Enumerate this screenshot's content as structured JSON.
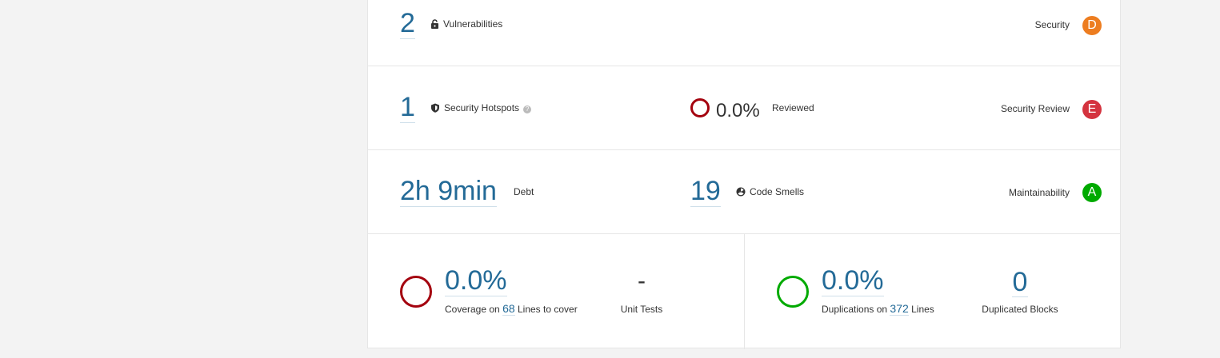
{
  "security": {
    "count": "2",
    "label": "Vulnerabilities",
    "rating_label": "Security",
    "rating": "D",
    "rating_color": "#ed7d20"
  },
  "hotspots": {
    "count": "1",
    "label": "Security Hotspots",
    "help": "?",
    "reviewed_pct": "0.0%",
    "reviewed_label": "Reviewed",
    "reviewed_ring_color": "#a4030f",
    "rating_label": "Security Review",
    "rating": "E",
    "rating_color": "#d4333f"
  },
  "maintainability": {
    "debt": "2h 9min",
    "debt_label": "Debt",
    "smells_count": "19",
    "smells_label": "Code Smells",
    "rating_label": "Maintainability",
    "rating": "A",
    "rating_color": "#00aa00"
  },
  "coverage": {
    "ring_color": "#a4030f",
    "value": "0.0%",
    "prefix": "Coverage on",
    "lines": "68",
    "suffix": "Lines to cover",
    "unit_tests_value": "-",
    "unit_tests_label": "Unit Tests"
  },
  "duplications": {
    "ring_color": "#00aa00",
    "value": "0.0%",
    "prefix": "Duplications on",
    "lines": "372",
    "suffix": "Lines",
    "blocks_value": "0",
    "blocks_label": "Duplicated Blocks"
  },
  "icons": {
    "vulnerability": "lock-icon",
    "hotspot": "shield-icon",
    "code_smell": "radiation-icon"
  }
}
